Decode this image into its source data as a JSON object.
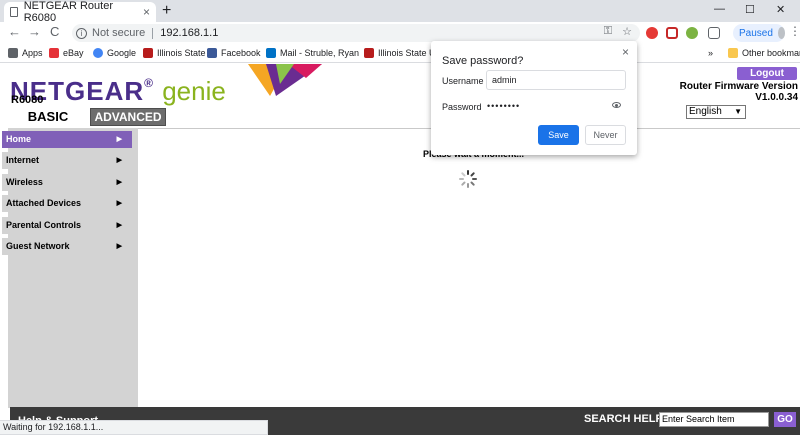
{
  "browser": {
    "tab_title": "NETGEAR Router R6080",
    "tab_close": "×",
    "new_tab": "+",
    "win_min": "—",
    "win_max": "☐",
    "win_close": "✕",
    "back": "←",
    "forward": "→",
    "reload": "C",
    "not_secure": "Not secure",
    "url": "192.168.1.1",
    "profile_label": "Paused",
    "menu": "⋮",
    "status_text": "Waiting for 192.168.1.1...",
    "bookmarks": {
      "apps": "Apps",
      "ebay": "eBay",
      "google": "Google",
      "illinois_state": "Illinois State",
      "facebook": "Facebook",
      "mail": "Mail - Struble, Ryan",
      "illinois_state_uni": "Illinois State Uni",
      "overflow": "»",
      "other_bookmarks": "Other bookmarks"
    }
  },
  "router": {
    "brand": "NETGEAR",
    "brand_sub": "genie",
    "model": "R6080",
    "tab_basic": "BASIC",
    "tab_advanced": "ADVANCED",
    "logout": "Logout",
    "firmware_label": "Router Firmware Version",
    "firmware_version": "V1.0.0.34",
    "language": "English",
    "nav": [
      {
        "label": "Home",
        "chev": "▶"
      },
      {
        "label": "Internet",
        "chev": "▶"
      },
      {
        "label": "Wireless",
        "chev": "▶"
      },
      {
        "label": "Attached Devices",
        "chev": "▶"
      },
      {
        "label": "Parental Controls",
        "chev": "▶"
      },
      {
        "label": "Guest Network",
        "chev": "▶"
      }
    ],
    "wait_message": "Please wait a moment...",
    "footer": {
      "help": "Help & Support",
      "search_help": "SEARCH HELP",
      "search_placeholder": "Enter Search Item",
      "go": "GO"
    }
  },
  "password_popup": {
    "title": "Save password?",
    "close": "×",
    "username_label": "Username",
    "username_value": "admin",
    "password_label": "Password",
    "password_value": "••••••••",
    "save": "Save",
    "never": "Never"
  },
  "colors": {
    "netgear_purple": "#4a2e8a",
    "genie_green": "#8ab31e",
    "nav_active": "#8060b8",
    "chrome_blue": "#1a73e8"
  }
}
